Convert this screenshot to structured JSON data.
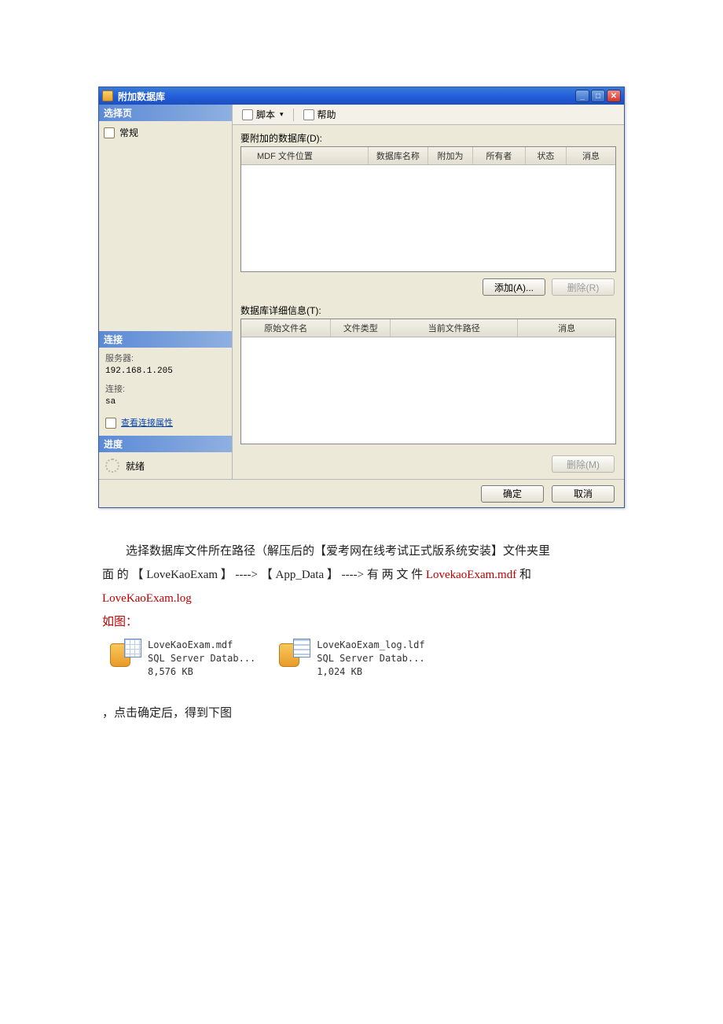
{
  "dialog": {
    "title": "附加数据库",
    "win_buttons": {
      "minimize": "_",
      "maximize": "□",
      "close": "✕"
    },
    "leftnav": {
      "select_page_header": "选择页",
      "general_item": "常规",
      "connection_header": "连接",
      "server_label": "服务器:",
      "server_value": "192.168.1.205",
      "connection_label": "连接:",
      "connection_value": "sa",
      "view_conn_props": "查看连接属性",
      "progress_header": "进度",
      "progress_status": "就绪"
    },
    "toolbar": {
      "script_label": "脚本",
      "dropdown_glyph": "▾",
      "help_label": "帮助"
    },
    "content": {
      "attach_label": "要附加的数据库(D):",
      "grid1_cols": [
        "MDF 文件位置",
        "数据库名称",
        "附加为",
        "所有者",
        "状态",
        "消息"
      ],
      "add_btn": "添加(A)...",
      "remove1_btn": "删除(R)",
      "detail_label": "数据库详细信息(T):",
      "grid2_cols": [
        "原始文件名",
        "文件类型",
        "当前文件路径",
        "消息"
      ],
      "remove2_btn": "删除(M)"
    },
    "footer": {
      "ok": "确定",
      "cancel": "取消"
    }
  },
  "doc": {
    "para1_indent": "　　选择数据库文件所在路径（解压后的【爱考网在线考试正式版系统安装】文件夹里",
    "para2_a": "面 的 【 LoveKaoExam 】 ----> 【 App_Data 】 ----> 有 两 文 件 ",
    "para2_red": "LovekaoExam.mdf",
    "para2_b": " 和",
    "para3_red": "LoveKaoExam.log",
    "para4_red": "如图：",
    "file1": {
      "name": "LoveKaoExam.mdf",
      "type": "SQL Server Datab...",
      "size": "8,576 KB"
    },
    "file2": {
      "name": "LoveKaoExam_log.ldf",
      "type": "SQL Server Datab...",
      "size": "1,024 KB"
    },
    "para5": "，点击确定后，得到下图"
  }
}
